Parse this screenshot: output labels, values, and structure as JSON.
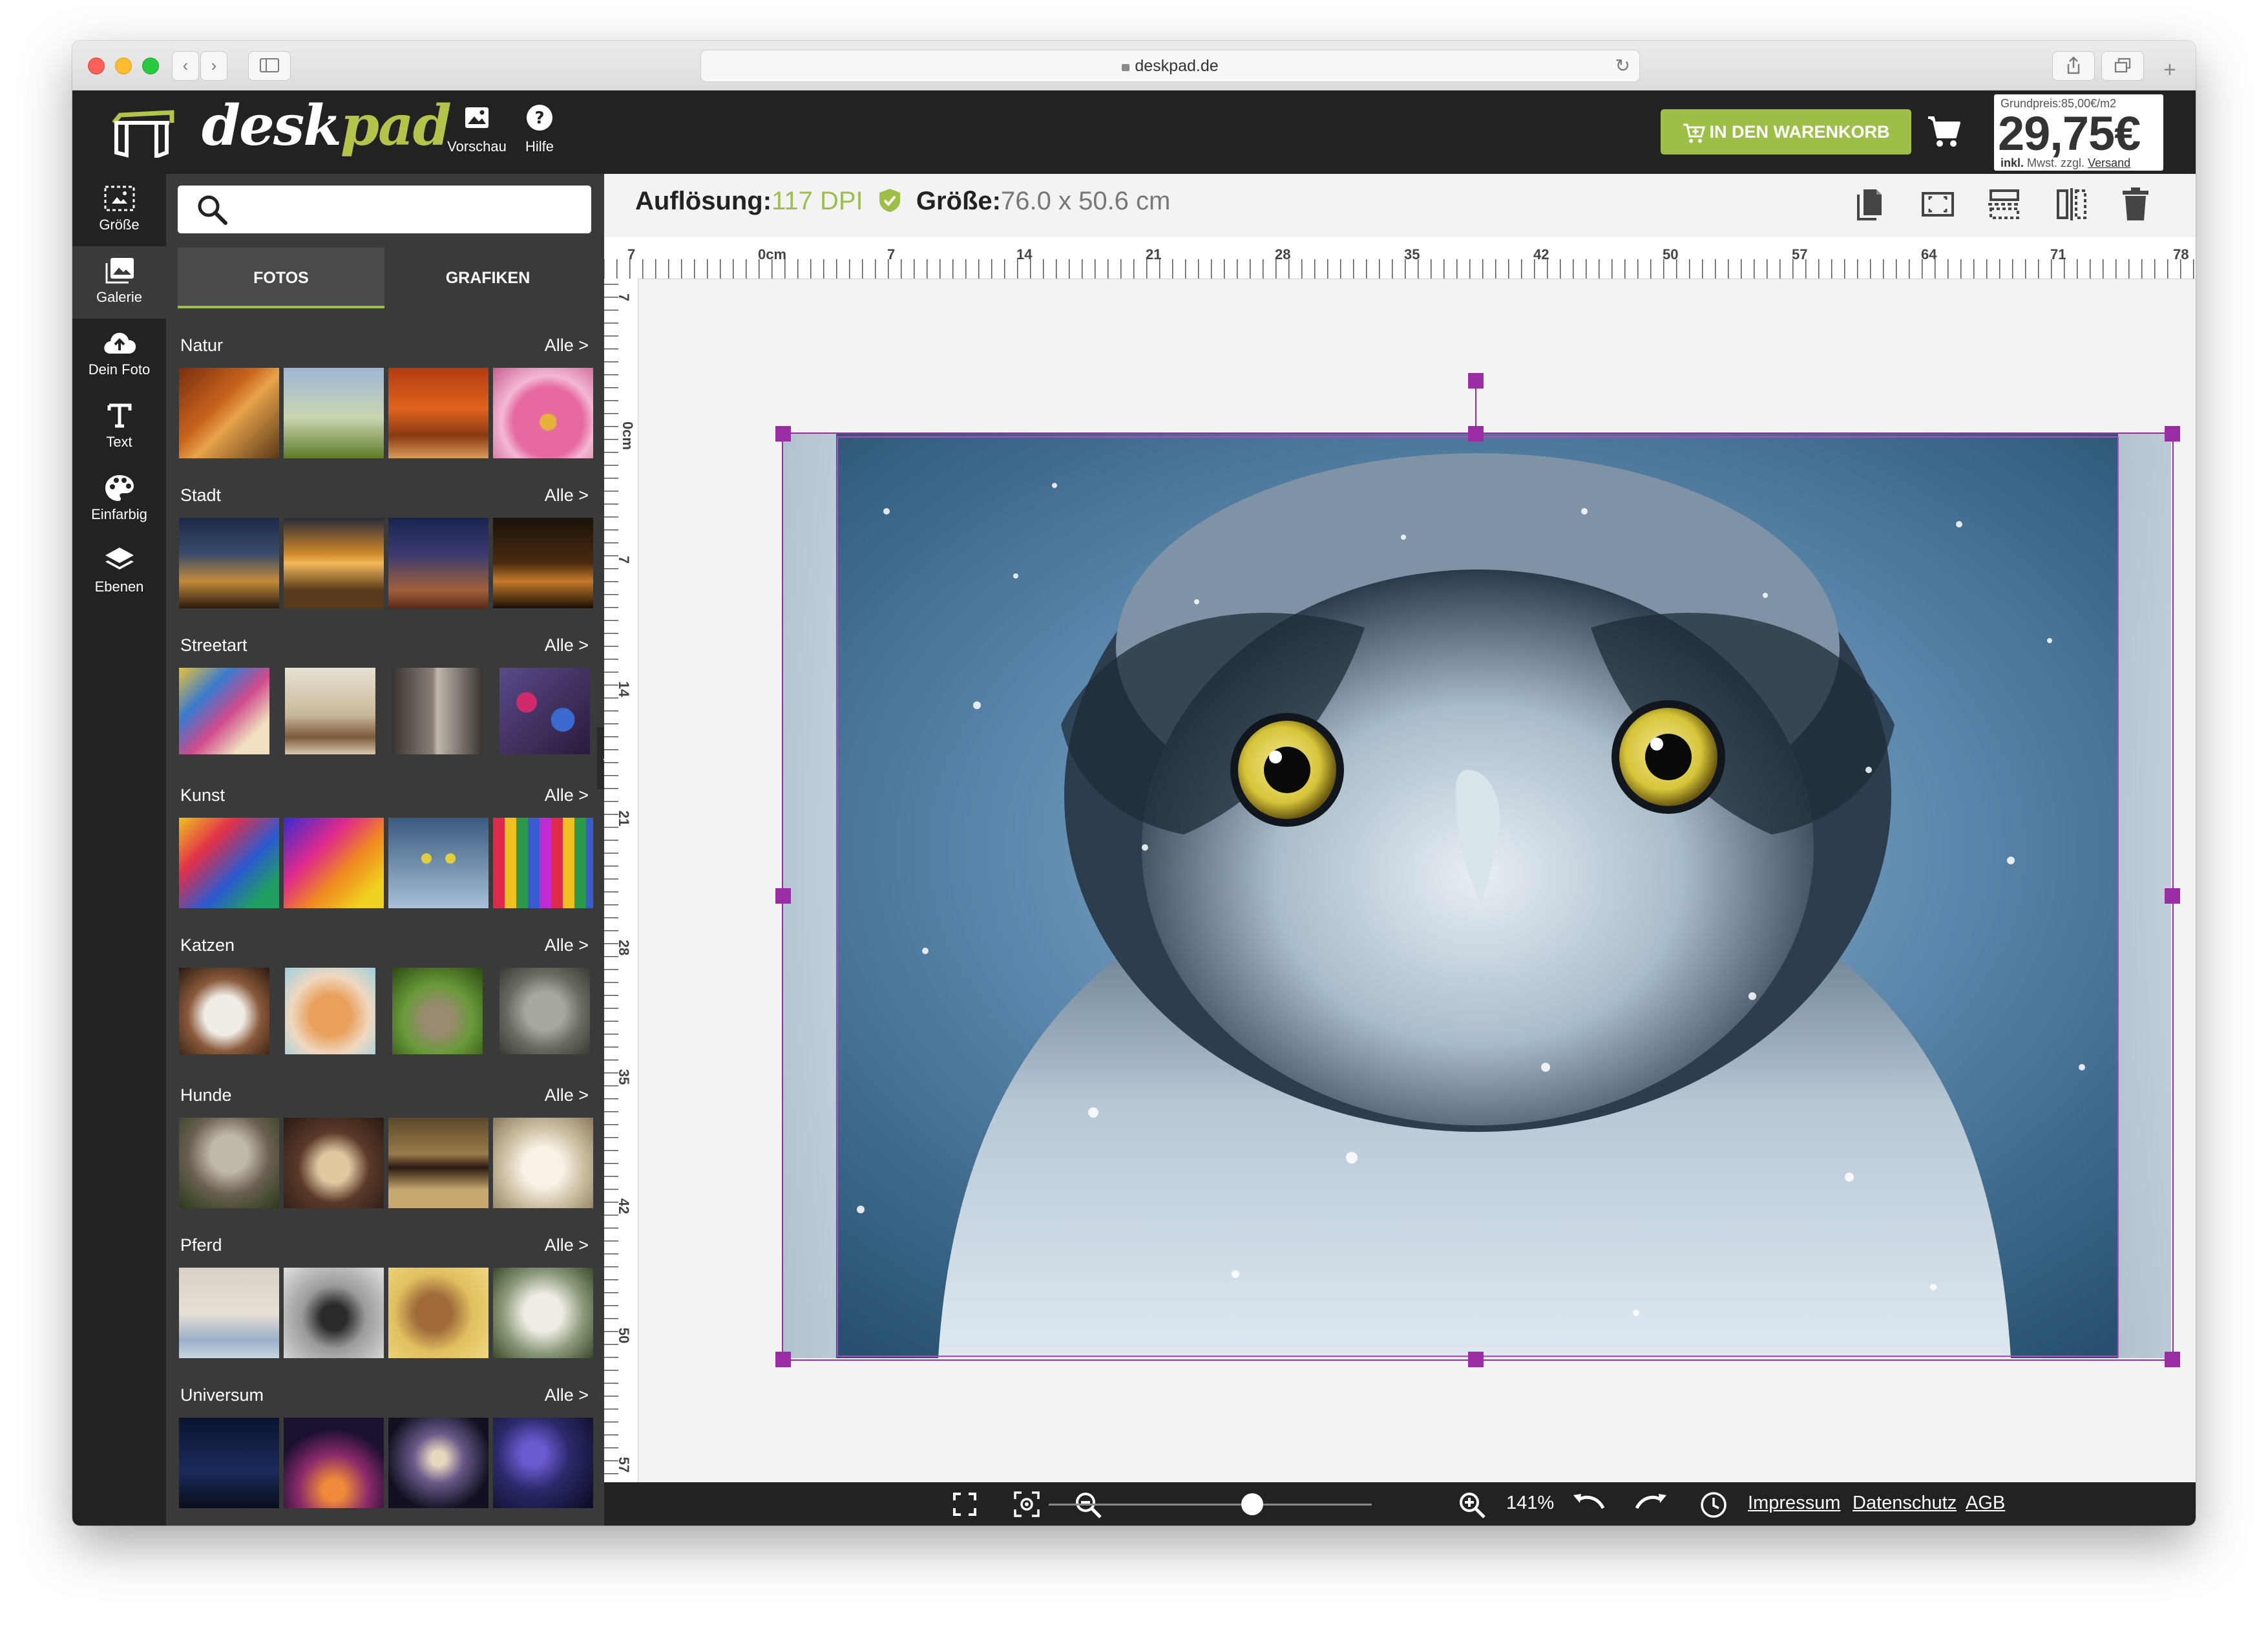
{
  "browser": {
    "url": "deskpad.de",
    "nav_back": "‹",
    "nav_forward": "›"
  },
  "header": {
    "logo_primary": "desk",
    "logo_accent": "pad",
    "preview_label": "Vorschau",
    "help_label": "Hilfe",
    "cart_button_label": "IN DEN WARENKORB",
    "price": {
      "grundpreis": "Grundpreis:85,00€/m2",
      "amount": "29,75€",
      "inkl": "inkl.",
      "note": "Mwst. zzgl.",
      "shipping": "Versand"
    }
  },
  "rail": {
    "items": [
      {
        "label": "Größe",
        "icon": "resize-icon"
      },
      {
        "label": "Galerie",
        "icon": "gallery-icon"
      },
      {
        "label": "Dein Foto",
        "icon": "cloud-upload-icon"
      },
      {
        "label": "Text",
        "icon": "text-icon"
      },
      {
        "label": "Einfarbig",
        "icon": "palette-icon"
      },
      {
        "label": "Ebenen",
        "icon": "layers-icon"
      }
    ]
  },
  "panel": {
    "search_placeholder": "",
    "tabs": [
      {
        "label": "FOTOS"
      },
      {
        "label": "GRAFIKEN"
      }
    ],
    "all_label": "Alle >",
    "categories": [
      {
        "name": "Natur"
      },
      {
        "name": "Stadt"
      },
      {
        "name": "Streetart"
      },
      {
        "name": "Kunst"
      },
      {
        "name": "Katzen"
      },
      {
        "name": "Hunde"
      },
      {
        "name": "Pferd"
      },
      {
        "name": "Universum"
      }
    ]
  },
  "workspace": {
    "resolution_label": "Auflösung:",
    "resolution_value": "117 DPI",
    "size_label": "Größe:",
    "size_value": "76.0 x 50.6 cm",
    "ruler_marks": [
      "7",
      "0cm",
      "7",
      "14",
      "21",
      "28",
      "35",
      "42",
      "50",
      "57",
      "64",
      "71",
      "78"
    ],
    "vruler_marks": [
      "7",
      "0cm",
      "7",
      "14",
      "21",
      "28",
      "35",
      "42",
      "50",
      "57"
    ]
  },
  "footer": {
    "zoom": "141%",
    "zoom_level": 0.63,
    "impressum": "Impressum",
    "datenschutz": "Datenschutz",
    "agb": "AGB"
  },
  "colors": {
    "accent_green": "#9dbf47",
    "selection_purple": "#9b2ca3",
    "dark_bg": "#222222",
    "panel_bg": "#3a3a3a"
  }
}
